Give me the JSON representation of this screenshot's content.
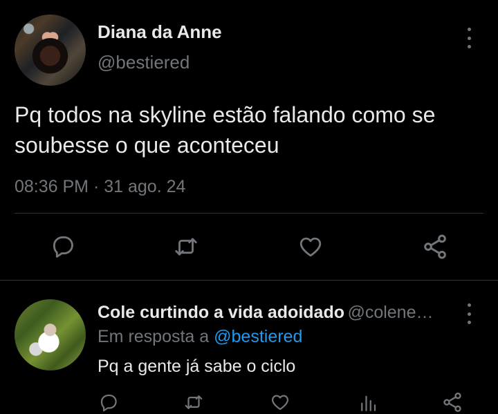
{
  "tweet": {
    "author_name": "Diana da Anne",
    "author_handle": "@bestiered",
    "text_line1": "Pq todos na skyline estão falando como se",
    "text_line2": "soubesse o que aconteceu",
    "time": "08:36 PM",
    "separator": "·",
    "date": "31 ago. 24",
    "actions": [
      "reply-icon",
      "retweet-icon",
      "like-icon",
      "share-icon"
    ]
  },
  "reply": {
    "author_name": "Cole curtindo a vida adoidado",
    "author_handle": "@colene…",
    "reply_prefix": "Em resposta a",
    "mention": "@bestiered",
    "text": "Pq a gente já sabe o ciclo",
    "actions": [
      "reply-icon",
      "retweet-icon",
      "like-icon",
      "views-icon",
      "share-icon"
    ]
  },
  "colors": {
    "background": "#000000",
    "text_primary": "#e7e9ea",
    "text_secondary": "#71767b",
    "accent": "#1d9bf0",
    "divider": "#2f3336"
  }
}
